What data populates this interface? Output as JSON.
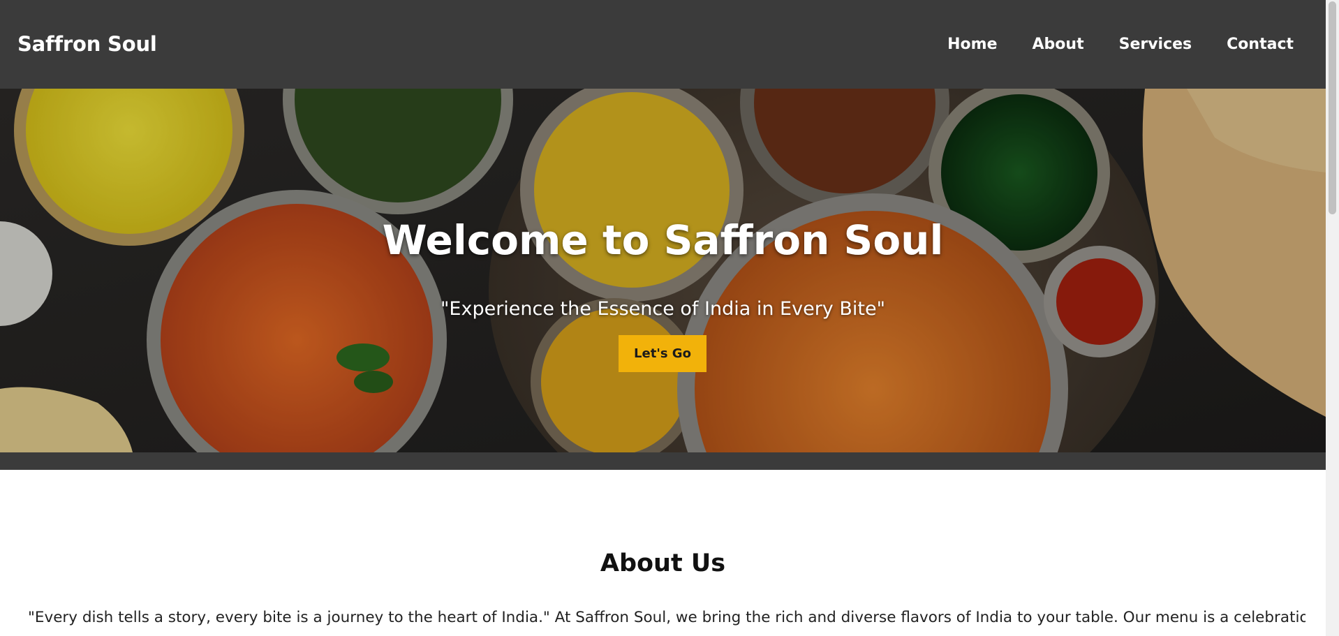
{
  "header": {
    "brand": "Saffron Soul",
    "nav": [
      "Home",
      "About",
      "Services",
      "Contact"
    ]
  },
  "hero": {
    "title": "Welcome to Saffron Soul",
    "subtitle": "\"Experience the Essence of India in Every Bite\"",
    "button_label": "Let's Go"
  },
  "about": {
    "title": "About Us",
    "text": "\"Every dish tells a story, every bite is a journey to the heart of India.\" At Saffron Soul, we bring the rich and diverse flavors of India to your table. Our menu is a celebration of"
  },
  "colors": {
    "header_bg": "#3b3b3b",
    "accent": "#f2b20a",
    "text_light": "#ffffff"
  },
  "icons": [
    "scrollbar-thumb"
  ]
}
